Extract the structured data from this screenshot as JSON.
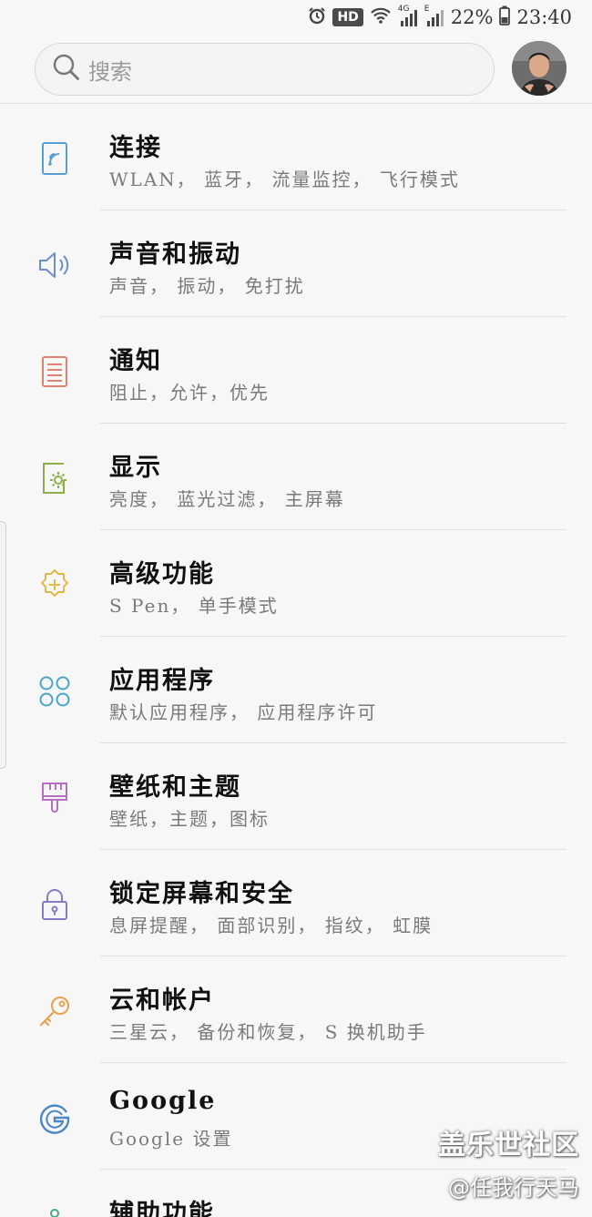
{
  "status_bar": {
    "hd": "HD",
    "network_4g": "4G",
    "network_e": "E",
    "battery_percent": "22%",
    "time": "23:40",
    "icons": [
      "alarm-icon",
      "wifi-icon",
      "signal-icon",
      "battery-icon"
    ]
  },
  "search": {
    "placeholder": "搜索"
  },
  "settings": [
    {
      "title": "连接",
      "subtitle": "WLAN， 蓝牙， 流量监控， 飞行模式",
      "icon": "connection-icon",
      "color": "#5a9fd4"
    },
    {
      "title": "声音和振动",
      "subtitle": "声音， 振动， 免打扰",
      "icon": "speaker-icon",
      "color": "#6a8fd0"
    },
    {
      "title": "通知",
      "subtitle": "阻止，允许，优先",
      "icon": "notification-icon",
      "color": "#e0826e"
    },
    {
      "title": "显示",
      "subtitle": "亮度， 蓝光过滤， 主屏幕",
      "icon": "display-icon",
      "color": "#8bb04a"
    },
    {
      "title": "高级功能",
      "subtitle": "S Pen， 单手模式",
      "icon": "advanced-features-icon",
      "color": "#e6b84a"
    },
    {
      "title": "应用程序",
      "subtitle": "默认应用程序， 应用程序许可",
      "icon": "apps-icon",
      "color": "#4aa6c8"
    },
    {
      "title": "壁纸和主题",
      "subtitle": "壁纸，主题，图标",
      "icon": "paintbrush-icon",
      "color": "#b76fc2"
    },
    {
      "title": "锁定屏幕和安全",
      "subtitle": "息屏提醒， 面部识别， 指纹， 虹膜",
      "icon": "lock-icon",
      "color": "#8a78c8"
    },
    {
      "title": "云和帐户",
      "subtitle": "三星云， 备份和恢复， S 换机助手",
      "icon": "key-icon",
      "color": "#e8a24e"
    },
    {
      "title": "Google",
      "subtitle": "Google 设置",
      "icon": "google-icon",
      "color": "#4a86c8"
    },
    {
      "title": "辅助功能",
      "subtitle": "",
      "icon": "accessibility-icon",
      "color": "#4aaa8a"
    }
  ],
  "watermark": {
    "line1": "盖乐世社区",
    "line2": "@任我行天马"
  }
}
